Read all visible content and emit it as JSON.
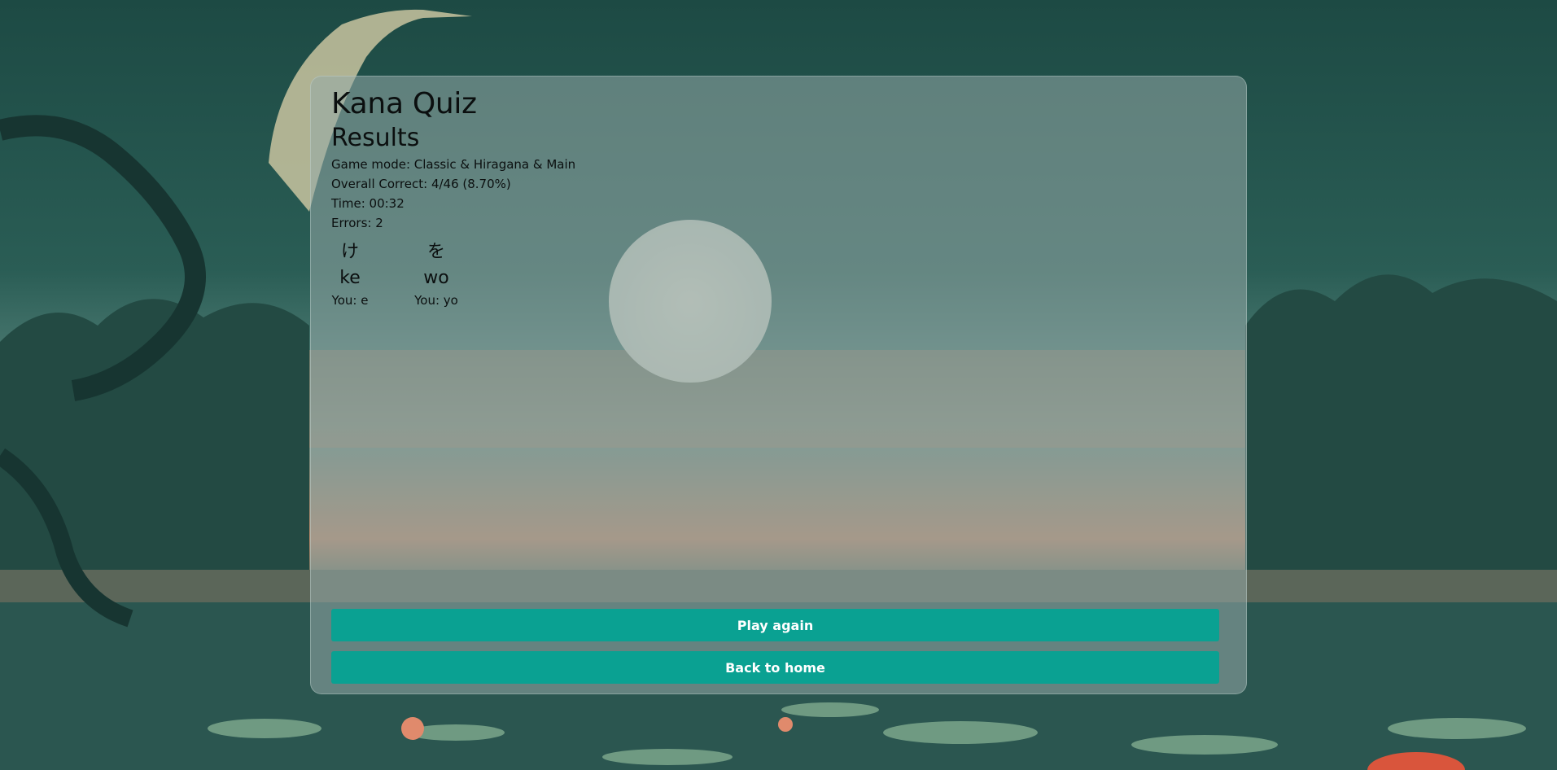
{
  "app": {
    "title": "Kana Quiz"
  },
  "results": {
    "heading": "Results",
    "game_mode": "Game mode: Classic & Hiragana & Main",
    "overall_correct": "Overall Correct: 4/46 (8.70%)",
    "time": "Time: 00:32",
    "errors": "Errors: 2"
  },
  "mistakes": [
    {
      "kana": "け",
      "romaji": "ke",
      "your_answer": "You: e"
    },
    {
      "kana": "を",
      "romaji": "wo",
      "your_answer": "You: yo"
    }
  ],
  "buttons": {
    "play_again": "Play again",
    "back_home": "Back to home"
  },
  "colors": {
    "button": "#0aa192",
    "panel": "rgba(150,170,168,0.55)"
  }
}
